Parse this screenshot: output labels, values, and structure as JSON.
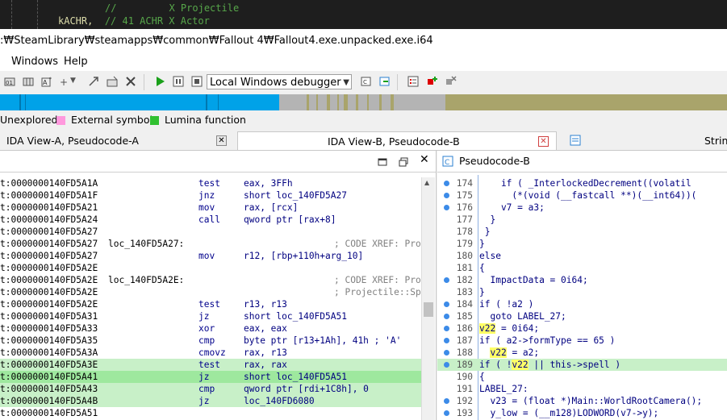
{
  "top_code": {
    "line1_comment": "//         X Projectile",
    "line2_code": "kACHR,",
    "line2_comment": "// 41 ACHR X Actor"
  },
  "title": ":₩SteamLibrary₩steamapps₩common₩Fallout 4₩Fallout4.exe.unpacked.exe.i64",
  "menu": [
    "Windows",
    "Help"
  ],
  "toolbar": {
    "debugger": "Local Windows debugger"
  },
  "colors": {
    "blue": "#00a2e8",
    "gray": "#b4b4b4",
    "olive": "#a9a46b",
    "highlight": "#c8f0c8",
    "selected": "#9ee89e"
  },
  "legend": [
    {
      "label": "Unexplored",
      "color": "#b4b4b4"
    },
    {
      "label": "External symbol",
      "color": "#ff99dd"
    },
    {
      "label": "Lumina function",
      "color": "#30c030"
    }
  ],
  "tabs": [
    {
      "label": "IDA View-A, Pseudocode-A",
      "active": false
    },
    {
      "label": "IDA View-B, Pseudocode-B",
      "active": true
    },
    {
      "label": "Strin",
      "active": false
    }
  ],
  "right_title": "Pseudocode-B",
  "disasm": [
    {
      "addr": "t:0000000140FD5A1A",
      "lbl": "",
      "mn": "test",
      "op": "eax, 3FFh",
      "cmt": ""
    },
    {
      "addr": "t:0000000140FD5A1F",
      "lbl": "",
      "mn": "jnz",
      "op": "short loc_140FD5A27",
      "cmt": ""
    },
    {
      "addr": "t:0000000140FD5A21",
      "lbl": "",
      "mn": "mov",
      "op": "rax, [rcx]",
      "cmt": ""
    },
    {
      "addr": "t:0000000140FD5A24",
      "lbl": "",
      "mn": "call",
      "op": "qword ptr [rax+8]",
      "cmt": ""
    },
    {
      "addr": "t:0000000140FD5A27",
      "lbl": "",
      "mn": "",
      "op": "",
      "cmt": ""
    },
    {
      "addr": "t:0000000140FD5A27",
      "lbl": "loc_140FD5A27:",
      "mn": "",
      "op": "",
      "cmt": "; CODE XREF: Pro"
    },
    {
      "addr": "t:0000000140FD5A27",
      "lbl": "",
      "mn": "mov",
      "op": "r12, [rbp+110h+arg_10]",
      "cmt": ""
    },
    {
      "addr": "t:0000000140FD5A2E",
      "lbl": "",
      "mn": "",
      "op": "",
      "cmt": ""
    },
    {
      "addr": "t:0000000140FD5A2E",
      "lbl": "loc_140FD5A2E:",
      "mn": "",
      "op": "",
      "cmt": "; CODE XREF: Pro"
    },
    {
      "addr": "t:0000000140FD5A2E",
      "lbl": "",
      "mn": "",
      "op": "",
      "cmt": "; Projectile::Sp"
    },
    {
      "addr": "t:0000000140FD5A2E",
      "lbl": "",
      "mn": "test",
      "op": "r13, r13",
      "cmt": ""
    },
    {
      "addr": "t:0000000140FD5A31",
      "lbl": "",
      "mn": "jz",
      "op": "short loc_140FD5A51",
      "cmt": ""
    },
    {
      "addr": "t:0000000140FD5A33",
      "lbl": "",
      "mn": "xor",
      "op": "eax, eax",
      "cmt": ""
    },
    {
      "addr": "t:0000000140FD5A35",
      "lbl": "",
      "mn": "cmp",
      "op": "byte ptr [r13+1Ah], 41h ; 'A'",
      "cmt": ""
    },
    {
      "addr": "t:0000000140FD5A3A",
      "lbl": "",
      "mn": "cmovz",
      "op": "rax, r13",
      "cmt": ""
    },
    {
      "addr": "t:0000000140FD5A3E",
      "lbl": "",
      "mn": "test",
      "op": "rax, rax",
      "cmt": "",
      "hl": 1
    },
    {
      "addr": "t:0000000140FD5A41",
      "lbl": "",
      "mn": "jz",
      "op": "short loc_140FD5A51",
      "cmt": "",
      "hl": 2
    },
    {
      "addr": "t:0000000140FD5A43",
      "lbl": "",
      "mn": "cmp",
      "op": "qword ptr [rdi+1C8h], 0",
      "cmt": "",
      "hl": 1
    },
    {
      "addr": "t:0000000140FD5A4B",
      "lbl": "",
      "mn": "jz",
      "op": "loc_140FD6080",
      "cmt": "",
      "hl": 1
    },
    {
      "addr": "t:0000000140FD5A51",
      "lbl": "",
      "mn": "",
      "op": "",
      "cmt": ""
    }
  ],
  "pseudocode": [
    {
      "n": "174",
      "dot": true,
      "src": "    if ( _InterlockedDecrement((volatil"
    },
    {
      "n": "175",
      "dot": true,
      "src": "      (*(void (__fastcall **)(__int64))("
    },
    {
      "n": "176",
      "dot": true,
      "src": "    v7 = a3;"
    },
    {
      "n": "177",
      "dot": false,
      "src": "  }"
    },
    {
      "n": "178",
      "dot": false,
      "src": " }"
    },
    {
      "n": "179",
      "dot": false,
      "src": "}"
    },
    {
      "n": "180",
      "dot": false,
      "src": "else"
    },
    {
      "n": "181",
      "dot": false,
      "src": "{"
    },
    {
      "n": "182",
      "dot": true,
      "src": "  ImpactData = 0i64;"
    },
    {
      "n": "183",
      "dot": false,
      "src": "}"
    },
    {
      "n": "184",
      "dot": true,
      "src": "if ( !a2 )"
    },
    {
      "n": "185",
      "dot": true,
      "src": "  goto LABEL_27;"
    },
    {
      "n": "186",
      "dot": true,
      "src": "v22 = 0i64;",
      "hlword": "v22"
    },
    {
      "n": "187",
      "dot": true,
      "src": "if ( a2->formType == 65 )"
    },
    {
      "n": "188",
      "dot": true,
      "src": "  v22 = a2;",
      "hlword": "v22"
    },
    {
      "n": "189",
      "dot": true,
      "src": "if ( !v22 || this->spell )",
      "hlword": "v22",
      "rowhl": true
    },
    {
      "n": "190",
      "dot": false,
      "src": "{"
    },
    {
      "n": "191",
      "dot": false,
      "src": "LABEL_27:"
    },
    {
      "n": "192",
      "dot": true,
      "src": "  v23 = (float *)Main::WorldRootCamera();"
    },
    {
      "n": "193",
      "dot": true,
      "src": "  y_low = (__m128)LODWORD(v7->y);"
    }
  ]
}
